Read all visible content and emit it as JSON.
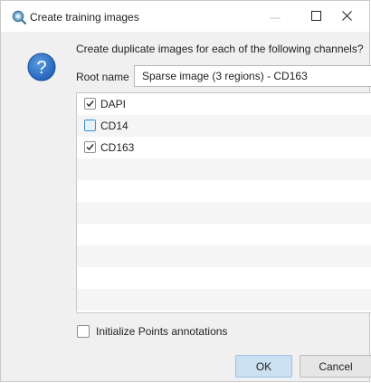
{
  "window": {
    "title": "Create training images",
    "app_icon": "magnifier-icon",
    "controls": {
      "minimize": "—",
      "maximize": "☐",
      "close": "✕"
    }
  },
  "dialog": {
    "icon": "question-icon",
    "prompt": "Create duplicate images for each of the following channels?",
    "root_name_label": "Root name",
    "root_name_value": "Sparse image (3 regions) - CD163",
    "channels": [
      {
        "label": "DAPI",
        "checked": true
      },
      {
        "label": "CD14",
        "checked": false
      },
      {
        "label": "CD163",
        "checked": true
      }
    ],
    "init_points_label": "Initialize Points annotations",
    "init_points_checked": false,
    "ok_label": "OK",
    "cancel_label": "Cancel"
  },
  "colors": {
    "accent": "#3c8fd8",
    "ok_button": "#cbe0f1",
    "dialog_bg": "#f0f0f0"
  }
}
